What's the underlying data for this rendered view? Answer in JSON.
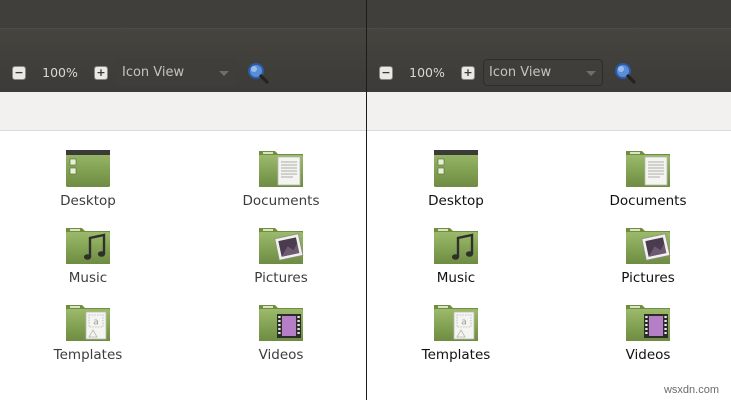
{
  "toolbar": {
    "zoom_out_glyph": "−",
    "zoom_in_glyph": "+",
    "zoom_level": "100%",
    "view_mode": "Icon View"
  },
  "folders": [
    {
      "label": "Desktop",
      "icon": "desktop-folder-icon"
    },
    {
      "label": "Documents",
      "icon": "documents-folder-icon"
    },
    {
      "label": "Music",
      "icon": "music-folder-icon"
    },
    {
      "label": "Pictures",
      "icon": "pictures-folder-icon"
    },
    {
      "label": "Templates",
      "icon": "templates-folder-icon"
    },
    {
      "label": "Videos",
      "icon": "videos-folder-icon"
    }
  ],
  "colors": {
    "folder_green": "#87a556",
    "toolbar_bg": "#3c3b37",
    "search_icon_blue": "#3b74c7"
  },
  "watermark": "wsxdn.com"
}
